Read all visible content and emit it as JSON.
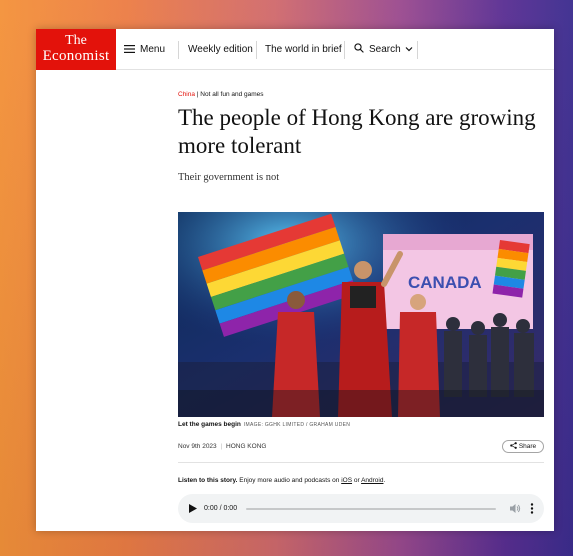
{
  "header": {
    "logo_line1": "The",
    "logo_line2": "Economist",
    "menu_label": "Menu",
    "weekly_edition": "Weekly edition",
    "world_in_brief": "The world in brief",
    "search_label": "Search"
  },
  "article": {
    "section": "China",
    "kicker_sep": " | ",
    "kicker": "Not all fun and games",
    "headline": "The people of Hong Kong are growing more tolerant",
    "subhead": "Their government is not",
    "caption": "Let the games begin",
    "credit": "IMAGE: GGHK LIMITED / GRAHAM UDEN",
    "date": "Nov 9th 2023",
    "date_sep": "|",
    "location": "HONG KONG",
    "share_label": "Share",
    "hero_text": "CANADA"
  },
  "listen": {
    "lead": "Listen to this story.",
    "text1": " Enjoy more audio and podcasts on ",
    "ios": "iOS",
    "or": " or ",
    "android": "Android",
    "period": "."
  },
  "audio": {
    "time": "0:00 / 0:00"
  },
  "colors": {
    "brand_red": "#e3120b"
  }
}
